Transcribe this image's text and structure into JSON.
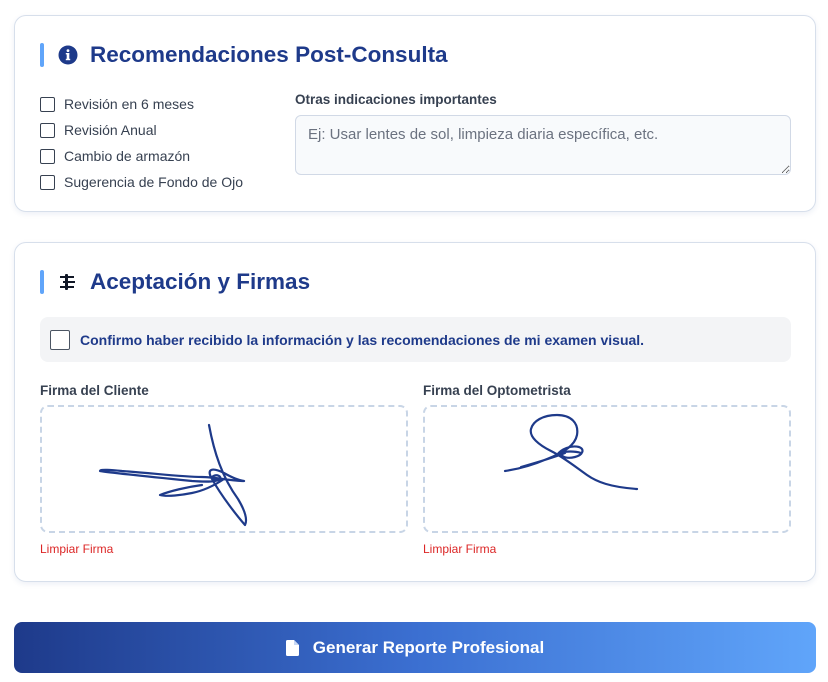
{
  "recommendations": {
    "title": "Recomendaciones Post-Consulta",
    "options": [
      {
        "label": "Revisión en 6 meses",
        "checked": false
      },
      {
        "label": "Revisión Anual",
        "checked": false
      },
      {
        "label": "Cambio de armazón",
        "checked": false
      },
      {
        "label": "Sugerencia de Fondo de Ojo",
        "checked": false
      }
    ],
    "notes_label": "Otras indicaciones importantes",
    "notes_placeholder": "Ej: Usar lentes de sol, limpieza diaria específica, etc.",
    "notes_value": ""
  },
  "signatures": {
    "title": "Aceptación y Firmas",
    "confirm_text": "Confirmo haber recibido la información y las recomendaciones de mi examen visual.",
    "confirm_checked": false,
    "client_label": "Firma del Cliente",
    "optometrist_label": "Firma del Optometrista",
    "clear_label": "Limpiar Firma",
    "ink_color": "#1e3a8a"
  },
  "actions": {
    "generate_label": "Generar Reporte Profesional"
  },
  "icons": {
    "recommendations": "info-circle-icon",
    "signatures": "signature-icon",
    "generate": "file-icon"
  },
  "colors": {
    "accent": "#1e3a8a",
    "accent_light": "#60a5fa",
    "danger": "#dc2626"
  }
}
